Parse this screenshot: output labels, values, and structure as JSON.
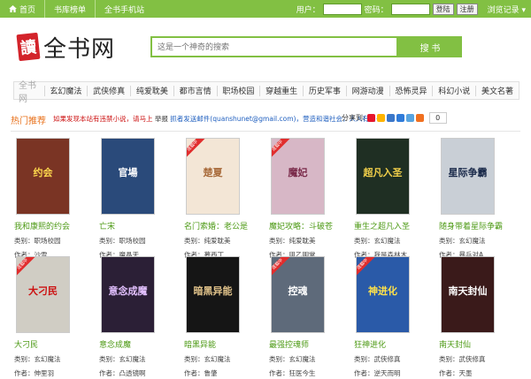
{
  "topbar": {
    "home": "首页",
    "ranking": "书库榜单",
    "mobile": "全书手机站",
    "user_label": "用户：",
    "password_label": "密码：",
    "login": "登陆",
    "register": "注册",
    "browse_history": "浏览记录 ▾"
  },
  "header": {
    "logo_mark": "讀",
    "logo_text": "全书网",
    "search_placeholder": "这是一个神奇的搜索",
    "search_button": "搜 书"
  },
  "nav": {
    "home": "全书网",
    "tabs": [
      "玄幻魔法",
      "武侠修真",
      "纯爱耽美",
      "都市言情",
      "职场校园",
      "穿越重生",
      "历史军事",
      "网游动漫",
      "恐怖灵异",
      "科幻小说",
      "美文名著"
    ]
  },
  "hot": {
    "title": "热门推荐",
    "notice_a": "如果发现本站有违禁小说，请马上",
    "notice_b": "举报",
    "notice_c": "抓者发送邮件(quanshunet@gmail.com)，营造和谐社会，人人有责~",
    "share_label": "分享到:",
    "share_count": "0"
  },
  "labels": {
    "category": "类别：",
    "author": "作者："
  },
  "badge_text": "连载中",
  "books": [
    {
      "title": "我和康熙的约会",
      "category": "职场校园",
      "author": "沙雪",
      "cover_bg": "#7a3424",
      "cover_text": "约会",
      "cover_fg": "#ffd94d",
      "badge": false
    },
    {
      "title": "亡宋",
      "category": "职场校园",
      "author": "魔晶天",
      "cover_bg": "#2a4a7a",
      "cover_text": "官場",
      "cover_fg": "#ffffff",
      "badge": false
    },
    {
      "title": "名门索婚：老公是",
      "category": "纯爱耽美",
      "author": "慕西丁",
      "cover_bg": "#f3e6d6",
      "cover_text": "楚夏",
      "cover_fg": "#a86a3a",
      "badge": true
    },
    {
      "title": "魔妃攻略：斗破苍",
      "category": "纯爱耽美",
      "author": "甲乙明堂",
      "cover_bg": "#d7b7c6",
      "cover_text": "魔妃",
      "cover_fg": "#7a2a4a",
      "badge": true
    },
    {
      "title": "重生之超凡入圣",
      "category": "玄幻魔法",
      "author": "我是森林木",
      "cover_bg": "#1f2f23",
      "cover_text": "超凡入圣",
      "cover_fg": "#f2d04a",
      "badge": false
    },
    {
      "title": "随身带着星际争霸",
      "category": "玄幻魔法",
      "author": "暴兵对A",
      "cover_bg": "#c9cfd6",
      "cover_text": "星际争霸",
      "cover_fg": "#1a2a4a",
      "badge": false
    },
    {
      "title": "大刁民",
      "category": "玄幻魔法",
      "author": "伸里羽",
      "cover_bg": "#d0cdc4",
      "cover_text": "大刁民",
      "cover_fg": "#cc1111",
      "badge": true
    },
    {
      "title": "意念成魔",
      "category": "玄幻魔法",
      "author": "凸透镜啊",
      "cover_bg": "#2b1f36",
      "cover_text": "意念成魔",
      "cover_fg": "#e2c0ff",
      "badge": false
    },
    {
      "title": "暗黑异能",
      "category": "玄幻魔法",
      "author": "鲁肇",
      "cover_bg": "#151515",
      "cover_text": "暗黑异能",
      "cover_fg": "#e0c28a",
      "badge": false
    },
    {
      "title": "最强控魂师",
      "category": "玄幻魔法",
      "author": "狂医今生",
      "cover_bg": "#5e6a7a",
      "cover_text": "控魂",
      "cover_fg": "#ffffff",
      "badge": true
    },
    {
      "title": "狂神进化",
      "category": "武侠修真",
      "author": "逆天而明",
      "cover_bg": "#2a5aa8",
      "cover_text": "神进化",
      "cover_fg": "#ffe24a",
      "badge": true
    },
    {
      "title": "南天封仙",
      "category": "武侠修真",
      "author": "天墨",
      "cover_bg": "#3a1a1a",
      "cover_text": "南天封仙",
      "cover_fg": "#ffffff",
      "badge": false
    }
  ],
  "colors": {
    "brand_green": "#82c043",
    "title_green": "#4d9a15",
    "accent_orange": "#e8701a",
    "notice_red": "#cc1111"
  }
}
